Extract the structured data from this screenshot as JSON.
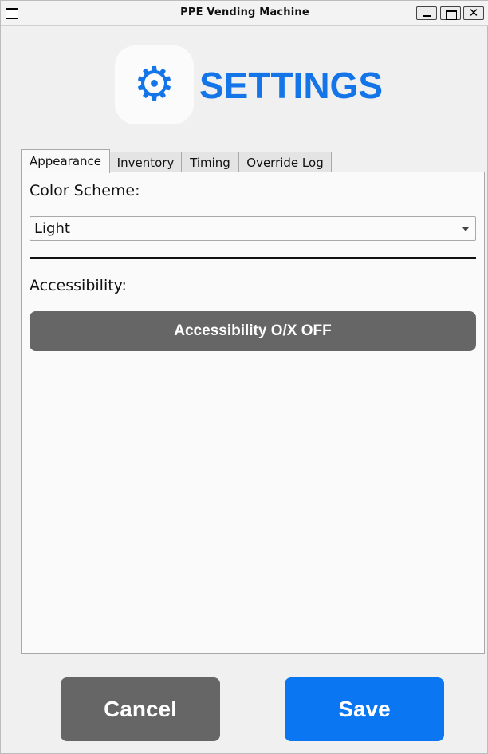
{
  "window": {
    "title": "PPE Vending Machine",
    "close_glyph": "✕"
  },
  "header": {
    "icon": "gear-icon",
    "icon_glyph": "⚙",
    "title": "SETTINGS"
  },
  "tabs": [
    {
      "label": "Appearance",
      "active": true
    },
    {
      "label": "Inventory",
      "active": false
    },
    {
      "label": "Timing",
      "active": false
    },
    {
      "label": "Override Log",
      "active": false
    }
  ],
  "appearance": {
    "color_scheme_label": "Color Scheme:",
    "color_scheme_value": "Light",
    "accessibility_label": "Accessibility:",
    "accessibility_button": "Accessibility O/X OFF"
  },
  "footer": {
    "cancel_label": "Cancel",
    "save_label": "Save"
  },
  "colors": {
    "accent": "#1475e8",
    "save_button": "#0a76f2",
    "gray_button": "#666666",
    "panel_background": "#fafafa"
  }
}
